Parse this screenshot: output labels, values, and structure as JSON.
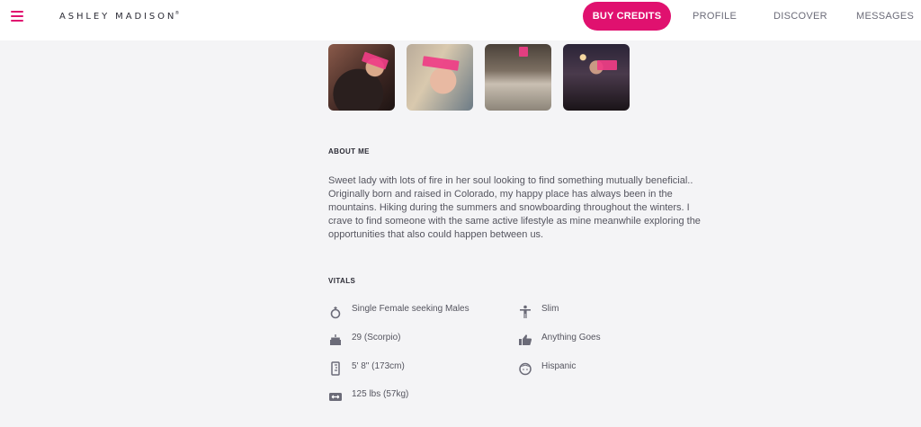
{
  "header": {
    "logo": "ASHLEY MADISON",
    "logo_mark": "®",
    "menu_icon": "hamburger-icon",
    "buy_credits": "BUY CREDITS",
    "nav": {
      "profile": "PROFILE",
      "discover": "DISCOVER",
      "messages": "MESSAGES"
    },
    "accent_color": "#e0116f"
  },
  "photos": [
    {
      "name": "profile-photo-1"
    },
    {
      "name": "profile-photo-2"
    },
    {
      "name": "profile-photo-3"
    },
    {
      "name": "profile-photo-4"
    }
  ],
  "about": {
    "title": "ABOUT ME",
    "text": "Sweet lady with lots of fire in her soul looking to find something mutually beneficial.. Originally born and raised in Colorado, my happy place has always been in the mountains. Hiking during the summers and snowboarding throughout the winters. I crave to find someone with the same active lifestyle as mine meanwhile exploring the opportunities that also could happen between us."
  },
  "vitals": {
    "title": "VITALS",
    "left": [
      {
        "icon": "ring-icon",
        "text": "Single Female seeking Males"
      },
      {
        "icon": "cake-icon",
        "text": "29 (Scorpio)"
      },
      {
        "icon": "ruler-icon",
        "text": "5' 8\" (173cm)"
      },
      {
        "icon": "scale-icon",
        "text": "125 lbs (57kg)"
      }
    ],
    "right": [
      {
        "icon": "body-icon",
        "text": "Slim"
      },
      {
        "icon": "thumbs-up-icon",
        "text": "Anything Goes"
      },
      {
        "icon": "face-icon",
        "text": "Hispanic"
      }
    ]
  }
}
